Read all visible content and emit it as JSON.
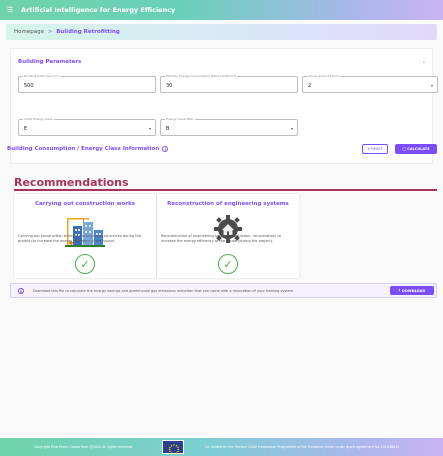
{
  "app": {
    "title": "Artificial Intelligence for Energy Efficiency",
    "menu_icon": "menu-icon"
  },
  "breadcrumb": {
    "home": "Homepage",
    "separator": ">",
    "current": "Building Retrofitting"
  },
  "parameters": {
    "heading": "Building Parameters",
    "fields": [
      {
        "label": "Building total area [m²]",
        "value": "500"
      },
      {
        "label": "Monthly Energy Consumption Before [kWh/m²]",
        "value": "30"
      },
      {
        "label": "Above-ground Floors",
        "value": "2"
      },
      {
        "label": "Initial Energy Class",
        "value": "E"
      },
      {
        "label": "Energy Class After",
        "value": "B"
      }
    ],
    "consumption_heading": "Building Consumption / Energy Class Information",
    "reset_label": "RESET",
    "calculate_label": "CALCULATE"
  },
  "recommendations": {
    "heading": "Recommendations",
    "cards": [
      {
        "title": "Carrying out construction works",
        "description": "Carrying out construction works in the enclosing structures during the project (to increase the energy efficiency of the house)."
      },
      {
        "title": "Reconstruction of engineering systems",
        "description": "Reconstruction of engineering systems (ventilation, recuperation) to increase the energy efficiency of the house (during the project)."
      }
    ]
  },
  "download_bar": {
    "text": "Download this file to calculate the energy savings and greenhouse gas emissions reduction that can come with a renovation of your heating system.",
    "button_label": "DOWNLOAD"
  },
  "footer": {
    "copyright": "Copyright EnerShare Consortium @2024 All rights reserved",
    "funding": "Co-funded by the Horizon 2020 Framework Programme of the European Union under grant agreement No 101036631"
  },
  "colors": {
    "accent": "#7c4dff",
    "heading": "#a8325b",
    "success": "#4caf50"
  }
}
